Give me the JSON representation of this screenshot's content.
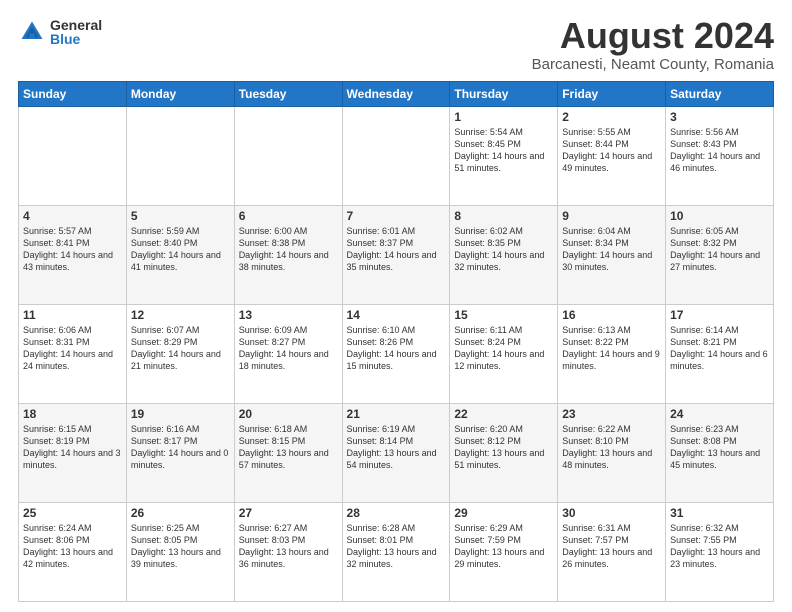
{
  "logo": {
    "general": "General",
    "blue": "Blue"
  },
  "title": "August 2024",
  "location": "Barcanesti, Neamt County, Romania",
  "days_of_week": [
    "Sunday",
    "Monday",
    "Tuesday",
    "Wednesday",
    "Thursday",
    "Friday",
    "Saturday"
  ],
  "weeks": [
    [
      {
        "day": "",
        "info": ""
      },
      {
        "day": "",
        "info": ""
      },
      {
        "day": "",
        "info": ""
      },
      {
        "day": "",
        "info": ""
      },
      {
        "day": "1",
        "info": "Sunrise: 5:54 AM\nSunset: 8:45 PM\nDaylight: 14 hours\nand 51 minutes."
      },
      {
        "day": "2",
        "info": "Sunrise: 5:55 AM\nSunset: 8:44 PM\nDaylight: 14 hours\nand 49 minutes."
      },
      {
        "day": "3",
        "info": "Sunrise: 5:56 AM\nSunset: 8:43 PM\nDaylight: 14 hours\nand 46 minutes."
      }
    ],
    [
      {
        "day": "4",
        "info": "Sunrise: 5:57 AM\nSunset: 8:41 PM\nDaylight: 14 hours\nand 43 minutes."
      },
      {
        "day": "5",
        "info": "Sunrise: 5:59 AM\nSunset: 8:40 PM\nDaylight: 14 hours\nand 41 minutes."
      },
      {
        "day": "6",
        "info": "Sunrise: 6:00 AM\nSunset: 8:38 PM\nDaylight: 14 hours\nand 38 minutes."
      },
      {
        "day": "7",
        "info": "Sunrise: 6:01 AM\nSunset: 8:37 PM\nDaylight: 14 hours\nand 35 minutes."
      },
      {
        "day": "8",
        "info": "Sunrise: 6:02 AM\nSunset: 8:35 PM\nDaylight: 14 hours\nand 32 minutes."
      },
      {
        "day": "9",
        "info": "Sunrise: 6:04 AM\nSunset: 8:34 PM\nDaylight: 14 hours\nand 30 minutes."
      },
      {
        "day": "10",
        "info": "Sunrise: 6:05 AM\nSunset: 8:32 PM\nDaylight: 14 hours\nand 27 minutes."
      }
    ],
    [
      {
        "day": "11",
        "info": "Sunrise: 6:06 AM\nSunset: 8:31 PM\nDaylight: 14 hours\nand 24 minutes."
      },
      {
        "day": "12",
        "info": "Sunrise: 6:07 AM\nSunset: 8:29 PM\nDaylight: 14 hours\nand 21 minutes."
      },
      {
        "day": "13",
        "info": "Sunrise: 6:09 AM\nSunset: 8:27 PM\nDaylight: 14 hours\nand 18 minutes."
      },
      {
        "day": "14",
        "info": "Sunrise: 6:10 AM\nSunset: 8:26 PM\nDaylight: 14 hours\nand 15 minutes."
      },
      {
        "day": "15",
        "info": "Sunrise: 6:11 AM\nSunset: 8:24 PM\nDaylight: 14 hours\nand 12 minutes."
      },
      {
        "day": "16",
        "info": "Sunrise: 6:13 AM\nSunset: 8:22 PM\nDaylight: 14 hours\nand 9 minutes."
      },
      {
        "day": "17",
        "info": "Sunrise: 6:14 AM\nSunset: 8:21 PM\nDaylight: 14 hours\nand 6 minutes."
      }
    ],
    [
      {
        "day": "18",
        "info": "Sunrise: 6:15 AM\nSunset: 8:19 PM\nDaylight: 14 hours\nand 3 minutes."
      },
      {
        "day": "19",
        "info": "Sunrise: 6:16 AM\nSunset: 8:17 PM\nDaylight: 14 hours\nand 0 minutes."
      },
      {
        "day": "20",
        "info": "Sunrise: 6:18 AM\nSunset: 8:15 PM\nDaylight: 13 hours\nand 57 minutes."
      },
      {
        "day": "21",
        "info": "Sunrise: 6:19 AM\nSunset: 8:14 PM\nDaylight: 13 hours\nand 54 minutes."
      },
      {
        "day": "22",
        "info": "Sunrise: 6:20 AM\nSunset: 8:12 PM\nDaylight: 13 hours\nand 51 minutes."
      },
      {
        "day": "23",
        "info": "Sunrise: 6:22 AM\nSunset: 8:10 PM\nDaylight: 13 hours\nand 48 minutes."
      },
      {
        "day": "24",
        "info": "Sunrise: 6:23 AM\nSunset: 8:08 PM\nDaylight: 13 hours\nand 45 minutes."
      }
    ],
    [
      {
        "day": "25",
        "info": "Sunrise: 6:24 AM\nSunset: 8:06 PM\nDaylight: 13 hours\nand 42 minutes."
      },
      {
        "day": "26",
        "info": "Sunrise: 6:25 AM\nSunset: 8:05 PM\nDaylight: 13 hours\nand 39 minutes."
      },
      {
        "day": "27",
        "info": "Sunrise: 6:27 AM\nSunset: 8:03 PM\nDaylight: 13 hours\nand 36 minutes."
      },
      {
        "day": "28",
        "info": "Sunrise: 6:28 AM\nSunset: 8:01 PM\nDaylight: 13 hours\nand 32 minutes."
      },
      {
        "day": "29",
        "info": "Sunrise: 6:29 AM\nSunset: 7:59 PM\nDaylight: 13 hours\nand 29 minutes."
      },
      {
        "day": "30",
        "info": "Sunrise: 6:31 AM\nSunset: 7:57 PM\nDaylight: 13 hours\nand 26 minutes."
      },
      {
        "day": "31",
        "info": "Sunrise: 6:32 AM\nSunset: 7:55 PM\nDaylight: 13 hours\nand 23 minutes."
      }
    ]
  ]
}
